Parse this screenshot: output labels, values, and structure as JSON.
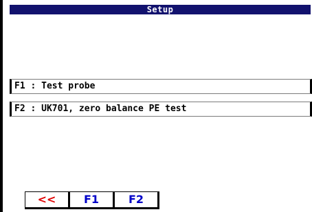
{
  "window": {
    "title": "Setup"
  },
  "menu": {
    "items": [
      {
        "label": "F1 : Test probe"
      },
      {
        "label": "F2 : UK701, zero balance PE test"
      }
    ]
  },
  "function_keys": {
    "back_label": "<<",
    "f1_label": "F1",
    "f2_label": "F2"
  },
  "colors": {
    "title_bar": "#12126e",
    "back_key": "#e00000",
    "function_key": "#0000c8"
  }
}
